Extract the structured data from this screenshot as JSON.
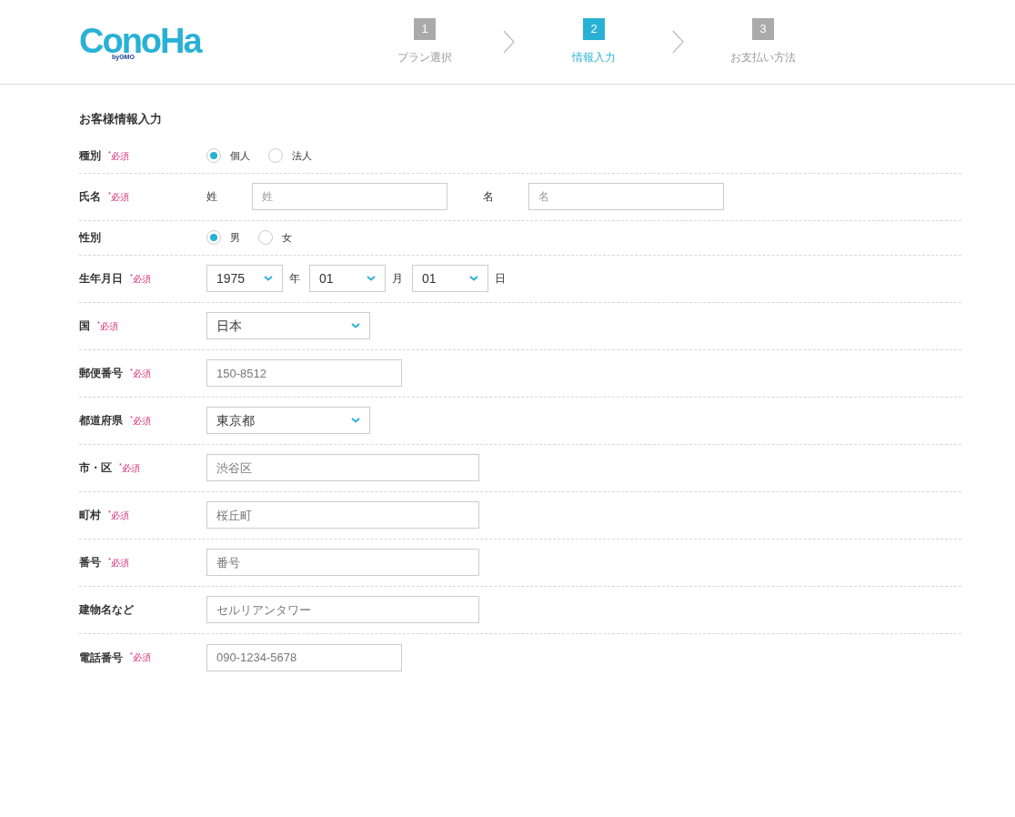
{
  "logo": {
    "text": "ConoHa",
    "sub": "byGMO"
  },
  "steps": [
    {
      "number": "1",
      "label": "プラン選択",
      "selected": false
    },
    {
      "number": "2",
      "label": "情報入力",
      "selected": true
    },
    {
      "number": "3",
      "label": "お支払い方法",
      "selected": false
    }
  ],
  "form": {
    "title": "お客様情報入力",
    "rows": [
      {
        "kind": "radio",
        "label": "種別",
        "required": "$^{*}$必須",
        "options": [
          {
            "label": "個人",
            "selected": true
          },
          {
            "label": "法人",
            "selected": false
          }
        ]
      },
      {
        "kind": "name",
        "label": "氏名",
        "required": "$^{*}$必須",
        "fields": [
          {
            "label": "姓",
            "placeholder": "姓"
          },
          {
            "label": "名",
            "placeholder": "名"
          }
        ]
      },
      {
        "kind": "radio",
        "label": "性別",
        "options": [
          {
            "label": "男",
            "selected": true
          },
          {
            "label": "女",
            "selected": false
          }
        ]
      },
      {
        "kind": "date",
        "label": "生年月日",
        "required": "$^{*}$必須",
        "selects": [
          {
            "value": "1975",
            "unit": "年"
          },
          {
            "value": "01",
            "unit": "月"
          },
          {
            "value": "01",
            "unit": "日"
          }
        ]
      },
      {
        "kind": "select",
        "label": "国",
        "required": "$^{*}$必須",
        "value": "日本"
      },
      {
        "kind": "text",
        "label": "郵便番号",
        "required": "$^{*}$必須",
        "placeholder": "150-8512",
        "wide": false
      },
      {
        "kind": "select",
        "label": "都道府県",
        "required": "$^{*}$必須",
        "value": "東京都"
      },
      {
        "kind": "text",
        "label": "市・区",
        "required": "$^{*}$必須",
        "placeholder": "渋谷区",
        "wide": true
      },
      {
        "kind": "text",
        "label": "町村",
        "required": "$^{*}$必須",
        "placeholder": "桜丘町",
        "wide": true
      },
      {
        "kind": "text",
        "label": "番号",
        "required": "$^{*}$必須",
        "placeholder": "番号",
        "wide": true
      },
      {
        "kind": "text",
        "label": "建物名など",
        "placeholder": "セルリアンタワー",
        "wide": true
      },
      {
        "kind": "text",
        "label": "電話番号",
        "required": "$^{*}$必須",
        "placeholder": "090-1234-5678",
        "wide": false
      }
    ]
  }
}
